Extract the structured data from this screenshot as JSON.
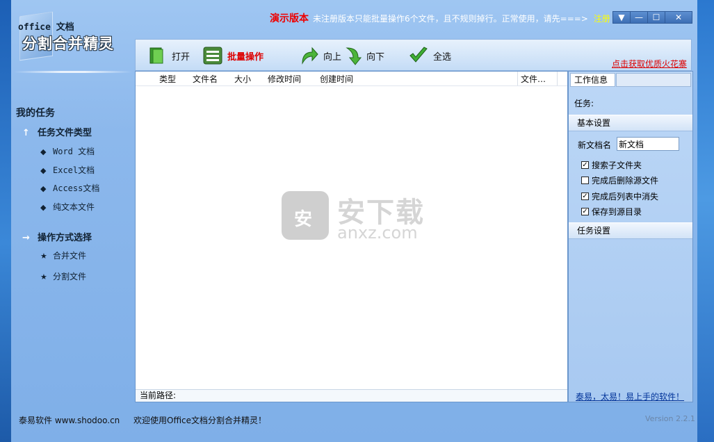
{
  "app": {
    "logo_top": "office 文档",
    "logo_main": "分割合并精灵",
    "demo_label": "演示版本",
    "demo_message": "未注册版本只能批量操作6个文件，且不规则掉行。正常使用，请先===>",
    "register_label": "注册",
    "window_buttons": {
      "menu": "▼",
      "minimize": "—",
      "maximize": "☐",
      "close": "✕"
    }
  },
  "sidebar": {
    "heading": "我的任务",
    "groups": [
      {
        "label": "任务文件类型",
        "icon": "up-arrow-icon",
        "items": [
          {
            "label": "Word 文档"
          },
          {
            "label": "Excel文档"
          },
          {
            "label": "Access文档"
          },
          {
            "label": "纯文本文件"
          }
        ]
      },
      {
        "label": "操作方式选择",
        "icon": "right-arrow-icon",
        "items": [
          {
            "label": "合并文件"
          },
          {
            "label": "分割文件"
          }
        ]
      }
    ]
  },
  "toolbar": {
    "open_label": "打开",
    "batch_label": "批量操作",
    "up_label": "向上",
    "down_label": "向下",
    "select_all_label": "全选",
    "promo_link": "点击获取优质火花寨"
  },
  "file_list": {
    "columns": [
      "类型",
      "文件名",
      "大小",
      "修改时间",
      "创建时间",
      "文件…"
    ],
    "rows": [],
    "path_label": "当前路径:"
  },
  "watermark": {
    "title": "安下载",
    "domain": "anxz.com"
  },
  "right_panel": {
    "tab_label": "工作信息",
    "task_label": "任务:",
    "basic_section": "基本设置",
    "new_doc_label": "新文档名",
    "new_doc_value": "新文档",
    "checkboxes": [
      {
        "label": "搜索子文件夹",
        "checked": true
      },
      {
        "label": "完成后删除源文件",
        "checked": false
      },
      {
        "label": "完成后列表中消失",
        "checked": true
      },
      {
        "label": "保存到源目录",
        "checked": true
      }
    ],
    "task_section": "任务设置",
    "slogan": "泰易，太易！易上手的软件！"
  },
  "status": {
    "company": "泰易软件 www.shodoo.cn",
    "welcome": "欢迎使用Office文档分割合并精灵！",
    "version": "Version 2.2.1"
  },
  "colors": {
    "demo_red": "#e00000",
    "register_yellow": "#ffff00",
    "accent_blue": "#7fafe8"
  }
}
